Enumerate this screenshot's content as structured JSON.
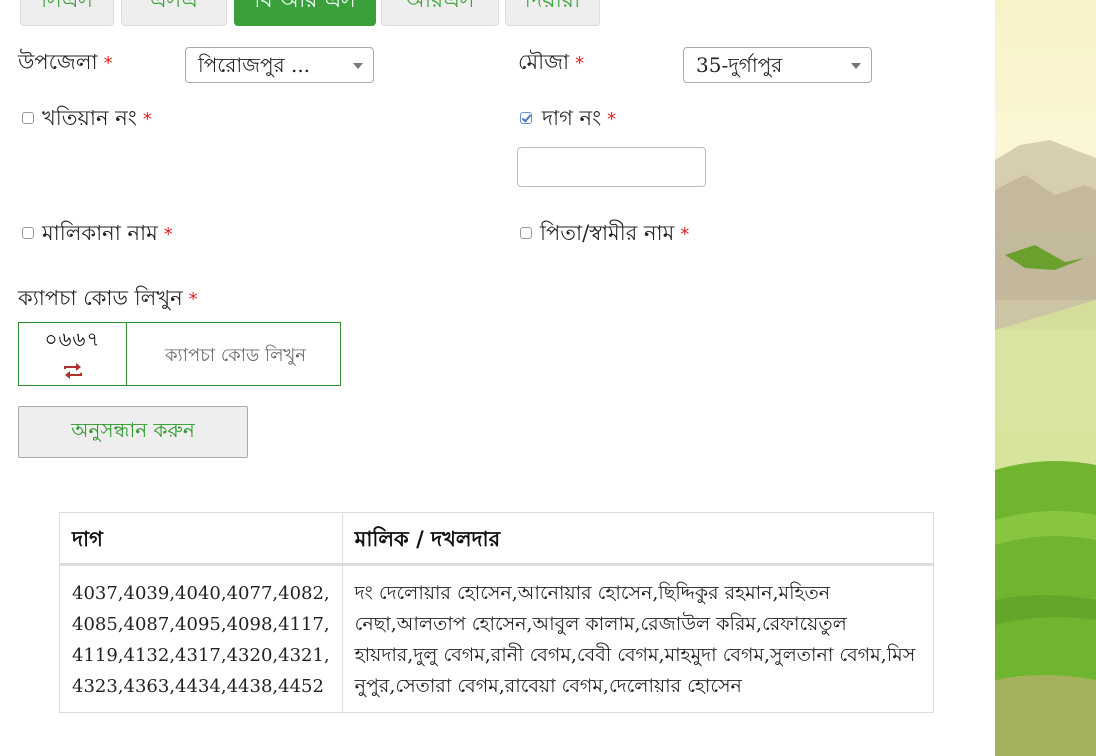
{
  "tabs": [
    "সিএস",
    "এসএ",
    "বি আর এস",
    "আরএস",
    "দিয়ারা"
  ],
  "active_tab_index": 2,
  "form": {
    "upazila": {
      "label": "উপজেলা",
      "value": "পিরোজপুর ..."
    },
    "mouza": {
      "label": "মৌজা",
      "value": "35-দুর্গাপুর"
    },
    "khatian": {
      "label": "খতিয়ান নং",
      "checked": false
    },
    "dag": {
      "label": "দাগ নং",
      "checked": true,
      "value": ""
    },
    "owner_name": {
      "label": "মালিকানা নাম",
      "checked": false
    },
    "father_name": {
      "label": "পিতা/স্বামীর নাম",
      "checked": false
    },
    "captcha": {
      "label": "ক্যাপচা কোড লিখুন",
      "code": "০৬৬৭",
      "placeholder": "ক্যাপচা কোড লিখুন"
    },
    "required_mark": "*",
    "search_button": "অনুসন্ধান করুন"
  },
  "icons": {
    "refresh": "refresh-icon",
    "caret": "chevron-down-icon",
    "checkbox": "checkbox-icon"
  },
  "colors": {
    "accent": "#3aa03a",
    "required": "#e02020"
  },
  "results": {
    "headers": [
      "দাগ",
      "মালিক / দখলদার"
    ],
    "rows": [
      {
        "dag": "4037,4039,4040,4077,4082, 4085,4087,4095,4098,4117, 4119,4132,4317,4320,4321, 4323,4363,4434,4438,4452",
        "owners": "দং দেলোয়ার হোসেন,আনোয়ার হোসেন,ছিদ্দিকুর রহমান,মহিতন নেছা,আলতাপ হোসেন,আবুল কালাম,রেজাউল করিম,রেফায়েতুল হায়দার,দুলু বেগম,রানী বেগম,বেবী বেগম,মাহমুদা বেগম,সুলতানা বেগম,মিস নুপুর,সেতারা বেগম,রাবেয়া বেগম,দেলোয়ার হোসেন"
      }
    ]
  }
}
